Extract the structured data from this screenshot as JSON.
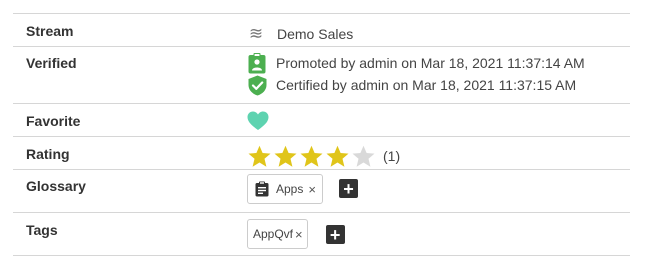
{
  "properties": {
    "stream": {
      "label": "Stream",
      "icon": "stream-icon",
      "value": "Demo Sales"
    },
    "verified": {
      "label": "Verified",
      "promoted_icon": "promoted-badge-icon",
      "promoted_text": "Promoted by admin on Mar 18, 2021 11:37:14 AM",
      "certified_icon": "certified-shield-icon",
      "certified_text": "Certified by admin on Mar 18, 2021 11:37:15 AM"
    },
    "favorite": {
      "label": "Favorite",
      "icon": "heart-icon",
      "is_favorite": true
    },
    "rating": {
      "label": "Rating",
      "stars": 4,
      "max_stars": 5,
      "count": "(1)"
    },
    "glossary": {
      "label": "Glossary",
      "items": [
        {
          "icon": "clipboard-icon",
          "label": "Apps",
          "remove": "×"
        }
      ],
      "add_label": "+"
    },
    "tags": {
      "label": "Tags",
      "items": [
        {
          "label": "AppQvf",
          "remove": "×"
        }
      ],
      "add_label": "+"
    }
  },
  "colors": {
    "border": "#d6d6d6",
    "promoted": "#4caf50",
    "certified": "#4caf50",
    "heart": "#5ed3b0",
    "star_filled": "#e0c51a",
    "star_empty": "#d9d9d9",
    "add_button": "#333333"
  }
}
